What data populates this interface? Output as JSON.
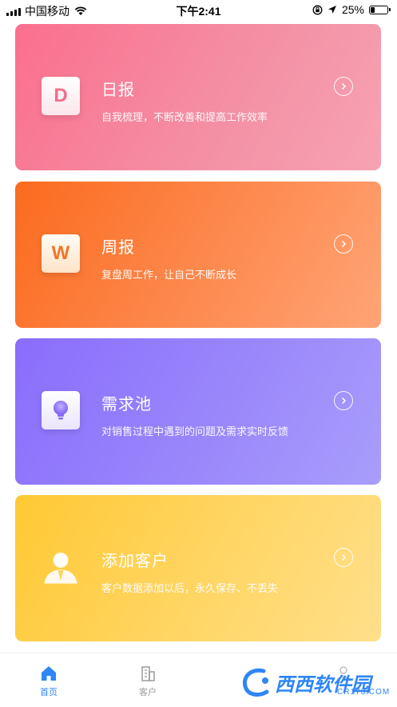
{
  "status_bar": {
    "carrier": "中国移动",
    "time": "下午2:41",
    "battery": "25%",
    "battery_level": 0.25
  },
  "cards": [
    {
      "icon_letter": "D",
      "title": "日报",
      "desc": "自我梳理，不断改善和提高工作效率",
      "arrow_icon": "chevron-right-circle-icon"
    },
    {
      "icon_letter": "W",
      "title": "周报",
      "desc": "复盘周工作，让自己不断成长",
      "arrow_icon": "chevron-right-circle-icon"
    },
    {
      "icon_name": "lightbulb-icon",
      "title": "需求池",
      "desc": "对销售过程中遇到的问题及需求实时反馈",
      "arrow_icon": "chevron-right-circle-icon"
    },
    {
      "icon_name": "person-icon",
      "title": "添加客户",
      "desc": "客户数据添加以后，永久保存、不丢失",
      "arrow_icon": "chevron-right-circle-icon"
    }
  ],
  "tab_bar": {
    "home_label": "首页",
    "customer_label": "客户",
    "active_color": "#2f86f6",
    "inactive_color": "#9a9a9a"
  },
  "watermark": {
    "text": "西西软件园",
    "sub": "CR173.COM"
  }
}
